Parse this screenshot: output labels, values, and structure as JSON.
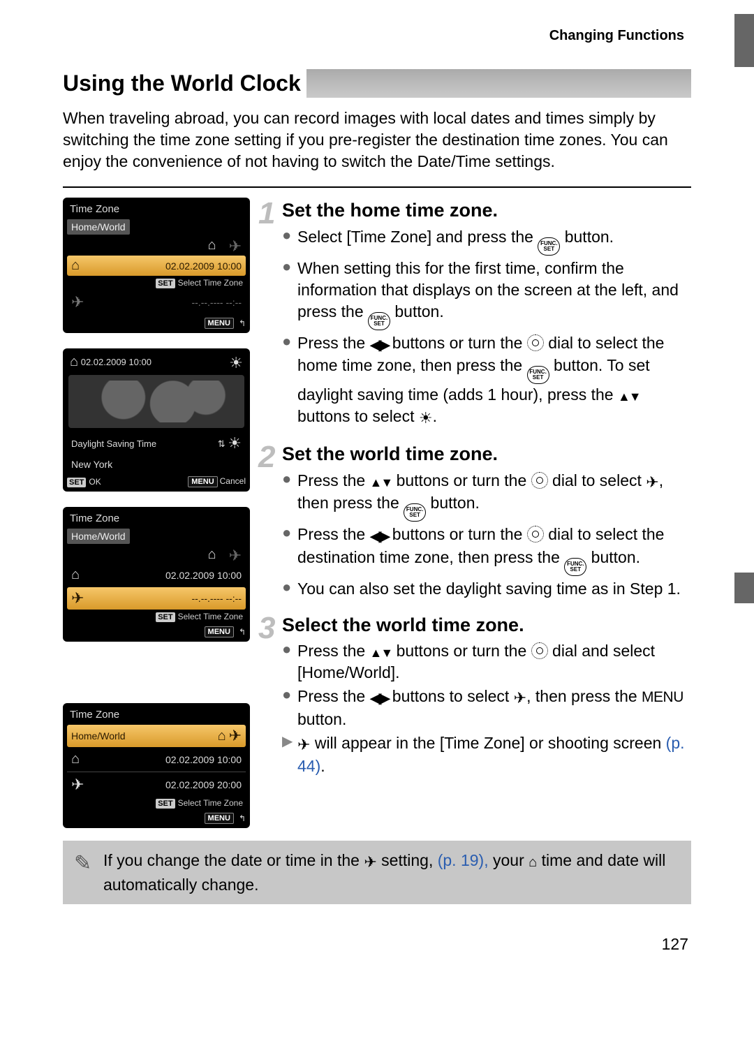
{
  "header": "Changing Functions",
  "title": "Using the World Clock",
  "intro": "When traveling abroad, you can record images with local dates and times simply by switching the time zone setting if you pre-register the destination time zones. You can enjoy the convenience of not having to switch the Date/Time settings.",
  "lcd1": {
    "title": "Time Zone",
    "home_world": "Home/World",
    "date": "02.02.2009 10:00",
    "select_tz": "Select Time Zone",
    "dash": "--.--.---- --:--",
    "set": "SET",
    "menu": "MENU"
  },
  "lcd2": {
    "top_date": "02.02.2009 10:00",
    "dst": "Daylight Saving Time",
    "city": "New York",
    "ok": "OK",
    "cancel": "Cancel",
    "set": "SET",
    "menu": "MENU"
  },
  "lcd3": {
    "title": "Time Zone",
    "home_world": "Home/World",
    "date": "02.02.2009 10:00",
    "dash": "--.--.---- --:--",
    "select_tz": "Select Time Zone",
    "set": "SET",
    "menu": "MENU"
  },
  "lcd4": {
    "title": "Time Zone",
    "home_world": "Home/World",
    "date1": "02.02.2009 10:00",
    "date2": "02.02.2009 20:00",
    "select_tz": "Select Time Zone",
    "set": "SET",
    "menu": "MENU"
  },
  "steps": {
    "s1": {
      "num": "1",
      "title": "Set the home time zone.",
      "b1a": "Select [Time Zone] and press the ",
      "b1b": " button.",
      "b2a": "When setting this for the first time, confirm the information that displays on the screen at the left, and press the ",
      "b2b": " button.",
      "b3a": "Press the ",
      "b3b": " buttons or turn the ",
      "b3c": " dial to select the home time zone, then press the ",
      "b3d": " button. To set daylight saving time (adds 1 hour), press the ",
      "b3e": " buttons to select ",
      "b3f": "."
    },
    "s2": {
      "num": "2",
      "title": "Set the world time zone.",
      "b1a": "Press the ",
      "b1b": " buttons or turn the ",
      "b1c": " dial to select ",
      "b1d": ", then press the ",
      "b1e": " button.",
      "b2a": "Press the ",
      "b2b": " buttons or turn the ",
      "b2c": " dial to select the destination time zone, then press the ",
      "b2d": " button.",
      "b3": "You can also set the daylight saving time as in Step 1."
    },
    "s3": {
      "num": "3",
      "title": "Select the world time zone.",
      "b1a": "Press the ",
      "b1b": " buttons or turn the ",
      "b1c": " dial and select [Home/World].",
      "b2a": "Press the ",
      "b2b": " buttons to select ",
      "b2c": ", then press the ",
      "b2d": " button.",
      "r1a": " will appear in the [Time Zone] or shooting screen ",
      "r1b": "(p. 44)",
      "r1c": "."
    }
  },
  "note": {
    "a": "If you change the date or time in the ",
    "b": " setting, ",
    "ref": "(p. 19),",
    "c": " your ",
    "d": " time and date will automatically change."
  },
  "labels": {
    "menu_word": "MENU"
  },
  "page_number": "127"
}
